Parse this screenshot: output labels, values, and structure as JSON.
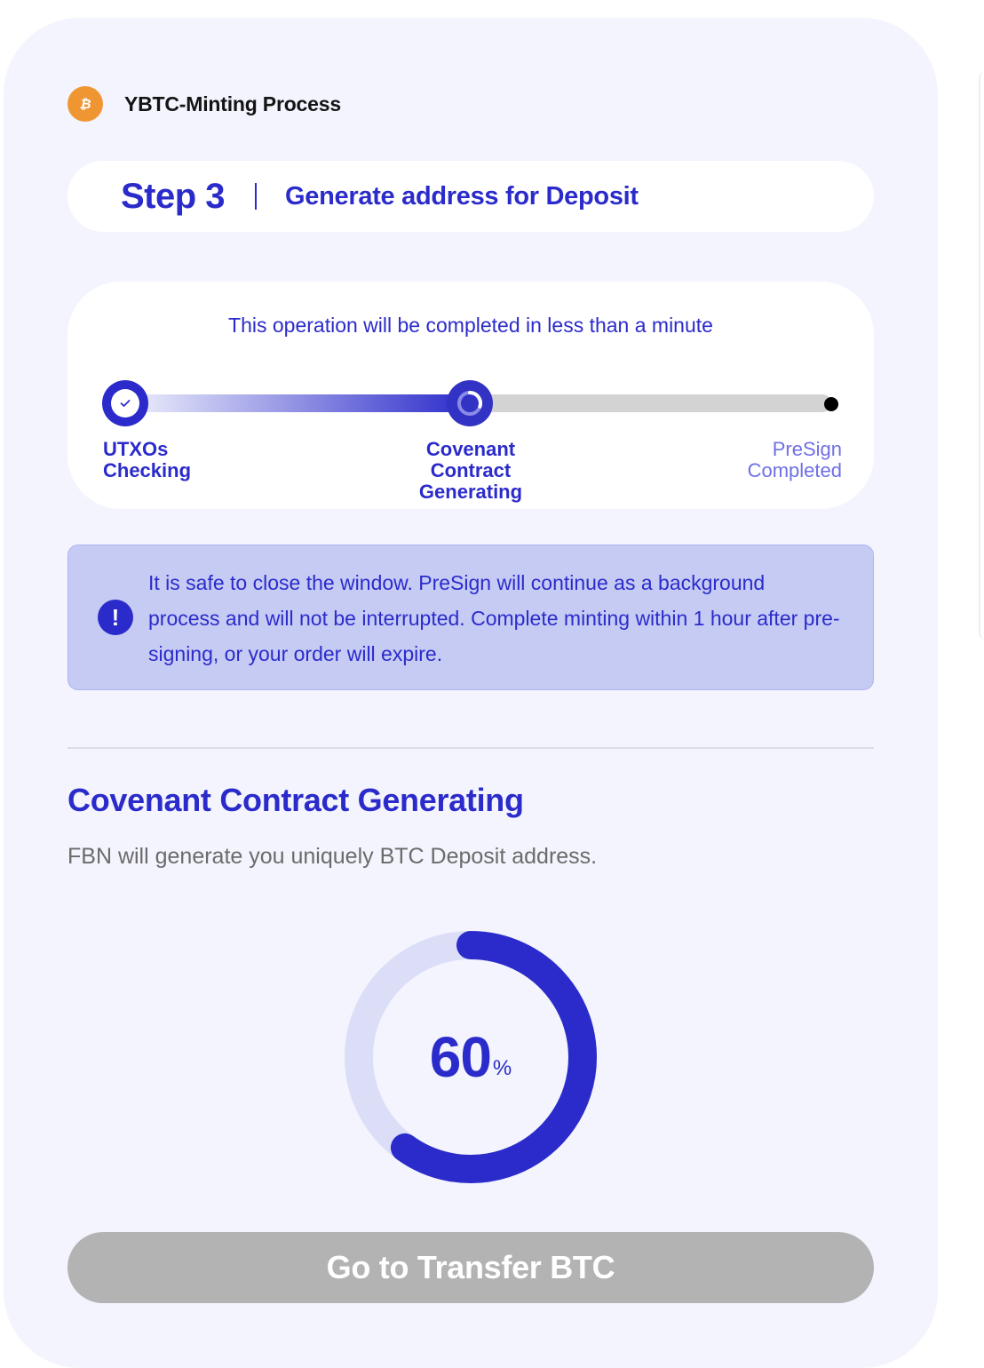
{
  "header": {
    "title": "YBTC-Minting Process",
    "logo_icon": "bitcoin-icon",
    "logo_color": "#ef9633"
  },
  "step": {
    "number_label": "Step 3",
    "title": "Generate address for Deposit"
  },
  "progress": {
    "note": "This operation will be completed in less than a minute",
    "stages": [
      {
        "label_lines": [
          "UTXOs",
          "Checking"
        ],
        "status": "completed"
      },
      {
        "label_lines": [
          "Covenant",
          "Contract",
          "Generating"
        ],
        "status": "in-progress"
      },
      {
        "label_lines": [
          "PreSign",
          "Completed"
        ],
        "status": "pending"
      }
    ]
  },
  "notice": {
    "icon": "exclamation-icon",
    "text": "It is safe to close the window. PreSign will continue as a background process and will not be interrupted. Complete minting within 1 hour after pre-signing, or your order will expire."
  },
  "section": {
    "title": "Covenant Contract Generating",
    "description": "FBN will generate you uniquely BTC Deposit address."
  },
  "percent": {
    "value": "60",
    "unit": "%",
    "fraction": 0.6
  },
  "cta": {
    "label": "Go to Transfer BTC",
    "enabled": false
  },
  "colors": {
    "accent": "#2b2bcb",
    "panel_bg": "#f3f4fd",
    "notice_bg": "#c6cbf4",
    "ring_track": "#dcdef8",
    "disabled_button": "#b3b3b3"
  }
}
